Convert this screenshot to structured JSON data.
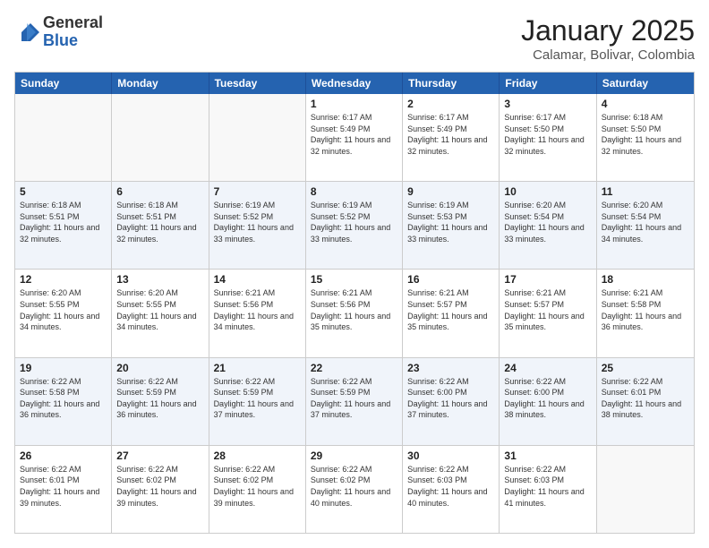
{
  "logo": {
    "general": "General",
    "blue": "Blue"
  },
  "header": {
    "month": "January 2025",
    "location": "Calamar, Bolivar, Colombia"
  },
  "weekdays": [
    "Sunday",
    "Monday",
    "Tuesday",
    "Wednesday",
    "Thursday",
    "Friday",
    "Saturday"
  ],
  "weeks": [
    [
      {
        "day": "",
        "sunrise": "",
        "sunset": "",
        "daylight": ""
      },
      {
        "day": "",
        "sunrise": "",
        "sunset": "",
        "daylight": ""
      },
      {
        "day": "",
        "sunrise": "",
        "sunset": "",
        "daylight": ""
      },
      {
        "day": "1",
        "sunrise": "Sunrise: 6:17 AM",
        "sunset": "Sunset: 5:49 PM",
        "daylight": "Daylight: 11 hours and 32 minutes."
      },
      {
        "day": "2",
        "sunrise": "Sunrise: 6:17 AM",
        "sunset": "Sunset: 5:49 PM",
        "daylight": "Daylight: 11 hours and 32 minutes."
      },
      {
        "day": "3",
        "sunrise": "Sunrise: 6:17 AM",
        "sunset": "Sunset: 5:50 PM",
        "daylight": "Daylight: 11 hours and 32 minutes."
      },
      {
        "day": "4",
        "sunrise": "Sunrise: 6:18 AM",
        "sunset": "Sunset: 5:50 PM",
        "daylight": "Daylight: 11 hours and 32 minutes."
      }
    ],
    [
      {
        "day": "5",
        "sunrise": "Sunrise: 6:18 AM",
        "sunset": "Sunset: 5:51 PM",
        "daylight": "Daylight: 11 hours and 32 minutes."
      },
      {
        "day": "6",
        "sunrise": "Sunrise: 6:18 AM",
        "sunset": "Sunset: 5:51 PM",
        "daylight": "Daylight: 11 hours and 32 minutes."
      },
      {
        "day": "7",
        "sunrise": "Sunrise: 6:19 AM",
        "sunset": "Sunset: 5:52 PM",
        "daylight": "Daylight: 11 hours and 33 minutes."
      },
      {
        "day": "8",
        "sunrise": "Sunrise: 6:19 AM",
        "sunset": "Sunset: 5:52 PM",
        "daylight": "Daylight: 11 hours and 33 minutes."
      },
      {
        "day": "9",
        "sunrise": "Sunrise: 6:19 AM",
        "sunset": "Sunset: 5:53 PM",
        "daylight": "Daylight: 11 hours and 33 minutes."
      },
      {
        "day": "10",
        "sunrise": "Sunrise: 6:20 AM",
        "sunset": "Sunset: 5:54 PM",
        "daylight": "Daylight: 11 hours and 33 minutes."
      },
      {
        "day": "11",
        "sunrise": "Sunrise: 6:20 AM",
        "sunset": "Sunset: 5:54 PM",
        "daylight": "Daylight: 11 hours and 34 minutes."
      }
    ],
    [
      {
        "day": "12",
        "sunrise": "Sunrise: 6:20 AM",
        "sunset": "Sunset: 5:55 PM",
        "daylight": "Daylight: 11 hours and 34 minutes."
      },
      {
        "day": "13",
        "sunrise": "Sunrise: 6:20 AM",
        "sunset": "Sunset: 5:55 PM",
        "daylight": "Daylight: 11 hours and 34 minutes."
      },
      {
        "day": "14",
        "sunrise": "Sunrise: 6:21 AM",
        "sunset": "Sunset: 5:56 PM",
        "daylight": "Daylight: 11 hours and 34 minutes."
      },
      {
        "day": "15",
        "sunrise": "Sunrise: 6:21 AM",
        "sunset": "Sunset: 5:56 PM",
        "daylight": "Daylight: 11 hours and 35 minutes."
      },
      {
        "day": "16",
        "sunrise": "Sunrise: 6:21 AM",
        "sunset": "Sunset: 5:57 PM",
        "daylight": "Daylight: 11 hours and 35 minutes."
      },
      {
        "day": "17",
        "sunrise": "Sunrise: 6:21 AM",
        "sunset": "Sunset: 5:57 PM",
        "daylight": "Daylight: 11 hours and 35 minutes."
      },
      {
        "day": "18",
        "sunrise": "Sunrise: 6:21 AM",
        "sunset": "Sunset: 5:58 PM",
        "daylight": "Daylight: 11 hours and 36 minutes."
      }
    ],
    [
      {
        "day": "19",
        "sunrise": "Sunrise: 6:22 AM",
        "sunset": "Sunset: 5:58 PM",
        "daylight": "Daylight: 11 hours and 36 minutes."
      },
      {
        "day": "20",
        "sunrise": "Sunrise: 6:22 AM",
        "sunset": "Sunset: 5:59 PM",
        "daylight": "Daylight: 11 hours and 36 minutes."
      },
      {
        "day": "21",
        "sunrise": "Sunrise: 6:22 AM",
        "sunset": "Sunset: 5:59 PM",
        "daylight": "Daylight: 11 hours and 37 minutes."
      },
      {
        "day": "22",
        "sunrise": "Sunrise: 6:22 AM",
        "sunset": "Sunset: 5:59 PM",
        "daylight": "Daylight: 11 hours and 37 minutes."
      },
      {
        "day": "23",
        "sunrise": "Sunrise: 6:22 AM",
        "sunset": "Sunset: 6:00 PM",
        "daylight": "Daylight: 11 hours and 37 minutes."
      },
      {
        "day": "24",
        "sunrise": "Sunrise: 6:22 AM",
        "sunset": "Sunset: 6:00 PM",
        "daylight": "Daylight: 11 hours and 38 minutes."
      },
      {
        "day": "25",
        "sunrise": "Sunrise: 6:22 AM",
        "sunset": "Sunset: 6:01 PM",
        "daylight": "Daylight: 11 hours and 38 minutes."
      }
    ],
    [
      {
        "day": "26",
        "sunrise": "Sunrise: 6:22 AM",
        "sunset": "Sunset: 6:01 PM",
        "daylight": "Daylight: 11 hours and 39 minutes."
      },
      {
        "day": "27",
        "sunrise": "Sunrise: 6:22 AM",
        "sunset": "Sunset: 6:02 PM",
        "daylight": "Daylight: 11 hours and 39 minutes."
      },
      {
        "day": "28",
        "sunrise": "Sunrise: 6:22 AM",
        "sunset": "Sunset: 6:02 PM",
        "daylight": "Daylight: 11 hours and 39 minutes."
      },
      {
        "day": "29",
        "sunrise": "Sunrise: 6:22 AM",
        "sunset": "Sunset: 6:02 PM",
        "daylight": "Daylight: 11 hours and 40 minutes."
      },
      {
        "day": "30",
        "sunrise": "Sunrise: 6:22 AM",
        "sunset": "Sunset: 6:03 PM",
        "daylight": "Daylight: 11 hours and 40 minutes."
      },
      {
        "day": "31",
        "sunrise": "Sunrise: 6:22 AM",
        "sunset": "Sunset: 6:03 PM",
        "daylight": "Daylight: 11 hours and 41 minutes."
      },
      {
        "day": "",
        "sunrise": "",
        "sunset": "",
        "daylight": ""
      }
    ]
  ]
}
